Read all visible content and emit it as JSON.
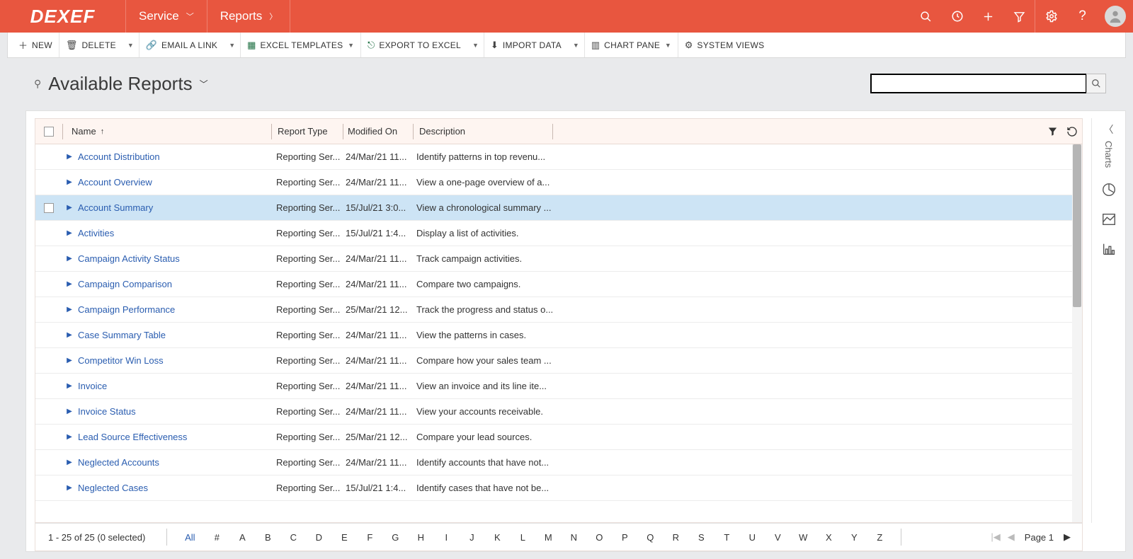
{
  "brand": "DEXEF",
  "nav": {
    "module": "Service",
    "sub": "Reports"
  },
  "cmd": {
    "new": "NEW",
    "delete": "DELETE",
    "email": "EMAIL A LINK",
    "excel_tpl": "EXCEL TEMPLATES",
    "export": "EXPORT TO EXCEL",
    "import": "IMPORT DATA",
    "chart": "CHART PANE",
    "sysviews": "SYSTEM VIEWS"
  },
  "title": "Available Reports",
  "columns": {
    "name": "Name",
    "type": "Report Type",
    "modified": "Modified On",
    "desc": "Description"
  },
  "rows": [
    {
      "name": "Account Distribution",
      "type": "Reporting Ser...",
      "modified": "24/Mar/21 11...",
      "desc": "Identify patterns in top revenu...",
      "sel": false
    },
    {
      "name": "Account Overview",
      "type": "Reporting Ser...",
      "modified": "24/Mar/21 11...",
      "desc": "View a one-page overview of a...",
      "sel": false
    },
    {
      "name": "Account Summary",
      "type": "Reporting Ser...",
      "modified": "15/Jul/21 3:0...",
      "desc": "View a chronological summary ...",
      "sel": true
    },
    {
      "name": "Activities",
      "type": "Reporting Ser...",
      "modified": "15/Jul/21 1:4...",
      "desc": "Display a list of activities.",
      "sel": false
    },
    {
      "name": "Campaign Activity Status",
      "type": "Reporting Ser...",
      "modified": "24/Mar/21 11...",
      "desc": "Track campaign activities.",
      "sel": false
    },
    {
      "name": "Campaign Comparison",
      "type": "Reporting Ser...",
      "modified": "24/Mar/21 11...",
      "desc": "Compare two campaigns.",
      "sel": false
    },
    {
      "name": "Campaign Performance",
      "type": "Reporting Ser...",
      "modified": "25/Mar/21 12...",
      "desc": "Track the progress and status o...",
      "sel": false
    },
    {
      "name": "Case Summary Table",
      "type": "Reporting Ser...",
      "modified": "24/Mar/21 11...",
      "desc": "View the patterns in cases.",
      "sel": false
    },
    {
      "name": "Competitor Win Loss",
      "type": "Reporting Ser...",
      "modified": "24/Mar/21 11...",
      "desc": "Compare how your sales team ...",
      "sel": false
    },
    {
      "name": "Invoice",
      "type": "Reporting Ser...",
      "modified": "24/Mar/21 11...",
      "desc": "View an invoice and its line ite...",
      "sel": false
    },
    {
      "name": "Invoice Status",
      "type": "Reporting Ser...",
      "modified": "24/Mar/21 11...",
      "desc": "View your accounts receivable.",
      "sel": false
    },
    {
      "name": "Lead Source Effectiveness",
      "type": "Reporting Ser...",
      "modified": "25/Mar/21 12...",
      "desc": "Compare your lead sources.",
      "sel": false
    },
    {
      "name": "Neglected Accounts",
      "type": "Reporting Ser...",
      "modified": "24/Mar/21 11...",
      "desc": "Identify accounts that have not...",
      "sel": false
    },
    {
      "name": "Neglected Cases",
      "type": "Reporting Ser...",
      "modified": "15/Jul/21 1:4...",
      "desc": "Identify cases that have not be...",
      "sel": false
    }
  ],
  "rail_label": "Charts",
  "footer": {
    "status": "1 - 25 of 25 (0 selected)",
    "all": "All",
    "letters": [
      "#",
      "A",
      "B",
      "C",
      "D",
      "E",
      "F",
      "G",
      "H",
      "I",
      "J",
      "K",
      "L",
      "M",
      "N",
      "O",
      "P",
      "Q",
      "R",
      "S",
      "T",
      "U",
      "V",
      "W",
      "X",
      "Y",
      "Z"
    ],
    "page_label": "Page 1"
  }
}
